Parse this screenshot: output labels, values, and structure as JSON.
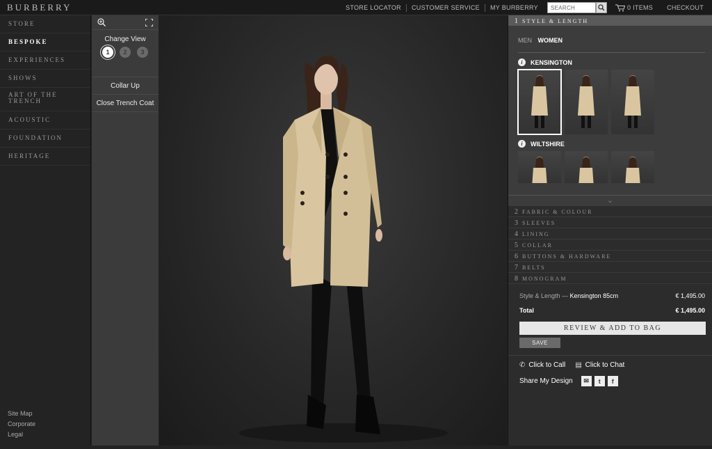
{
  "brand": "BURBERRY",
  "topnav": {
    "links": [
      "STORE LOCATOR",
      "CUSTOMER SERVICE",
      "MY BURBERRY"
    ],
    "search_placeholder": "SEARCH",
    "cart_label": "0 ITEMS",
    "checkout": "CHECKOUT"
  },
  "sidebar": {
    "items": [
      "STORE",
      "BESPOKE",
      "EXPERIENCES",
      "SHOWS",
      "ART OF THE TRENCH",
      "ACOUSTIC",
      "FOUNDATION",
      "HERITAGE"
    ],
    "active": "BESPOKE",
    "footer": [
      "Site Map",
      "Corporate",
      "Legal"
    ]
  },
  "view_panel": {
    "change_view": "Change View",
    "views": [
      "1",
      "2",
      "3"
    ],
    "selected_view": "1",
    "options": [
      "Collar Up",
      "Close Trench Coat"
    ]
  },
  "config": {
    "steps": [
      {
        "num": "1",
        "label": "STYLE & LENGTH"
      },
      {
        "num": "2",
        "label": "FABRIC & COLOUR"
      },
      {
        "num": "3",
        "label": "SLEEVES"
      },
      {
        "num": "4",
        "label": "LINING"
      },
      {
        "num": "5",
        "label": "COLLAR"
      },
      {
        "num": "6",
        "label": "BUTTONS & HARDWARE"
      },
      {
        "num": "7",
        "label": "BELTS"
      },
      {
        "num": "8",
        "label": "MONOGRAM"
      }
    ],
    "gender_men": "MEN",
    "gender_women": "WOMEN",
    "groups": [
      {
        "name": "KENSINGTON",
        "thumb_count": 3,
        "selected_index": 0
      },
      {
        "name": "WILTSHIRE",
        "thumb_count": 3
      }
    ]
  },
  "summary": {
    "line_label": "Style & Length — ",
    "line_value": "Kensington 85cm",
    "line_price": "€ 1,495.00",
    "total_label": "Total",
    "total_price": "€ 1,495.00",
    "review_button": "REVIEW & ADD TO BAG",
    "save_button": "SAVE"
  },
  "contact": {
    "call": "Click to Call",
    "chat": "Click to Chat",
    "share": "Share My Design",
    "share_icons": [
      "email-icon",
      "twitter-icon",
      "facebook-icon"
    ]
  },
  "colors": {
    "coat": "#d9c6a0",
    "background": "#232323",
    "panel": "#3b3b3b"
  }
}
